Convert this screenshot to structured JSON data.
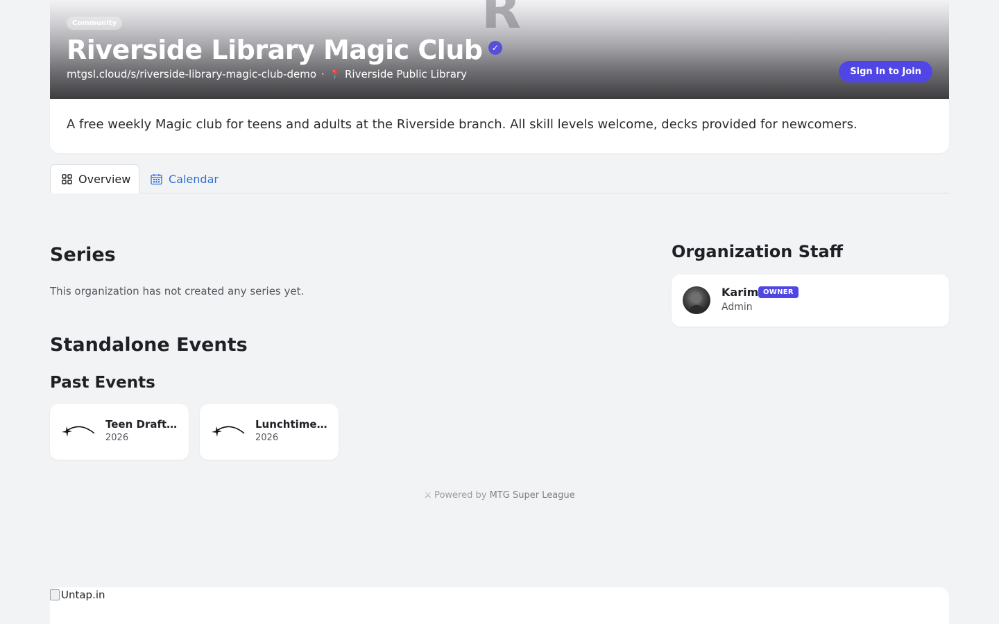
{
  "header": {
    "category_chip": "Community",
    "banner_letter": "R",
    "title": "Riverside Library Magic Club",
    "verified_icon": "check-badge-icon",
    "url": "mtgsl.cloud/s/riverside-library-magic-club-demo",
    "separator": "·",
    "location_icon": "map-pin-icon",
    "location": "Riverside Public Library",
    "join_button": "Sign In to Join"
  },
  "description": "A free weekly Magic club for teens and adults at the Riverside branch. All skill levels welcome, decks provided for newcomers.",
  "tabs": [
    {
      "label": "Overview",
      "icon": "grid-icon",
      "active": true
    },
    {
      "label": "Calendar",
      "icon": "calendar-icon",
      "active": false
    }
  ],
  "series": {
    "heading": "Series",
    "empty_text": "This organization has not created any series yet."
  },
  "standalone": {
    "heading": "Standalone Events",
    "past_heading": "Past Events",
    "events": [
      {
        "name": "Teen Draft ...",
        "year": "2026",
        "icon": "shooting-star-icon"
      },
      {
        "name": "Lunchtime ...",
        "year": "2026",
        "icon": "shooting-star-icon"
      }
    ]
  },
  "staff": {
    "heading": "Organization Staff",
    "members": [
      {
        "name": "Karim",
        "badge": "OWNER",
        "role": "Admin"
      }
    ]
  },
  "footer": {
    "powered_prefix": "Powered by",
    "powered_brand": "MTG Super League",
    "icon": "crossed-swords-icon"
  },
  "bottom_image_alt": "Untap.in",
  "colors": {
    "accent": "#4f46e5",
    "link": "#2f6fd6",
    "background": "#f2f3f5"
  }
}
